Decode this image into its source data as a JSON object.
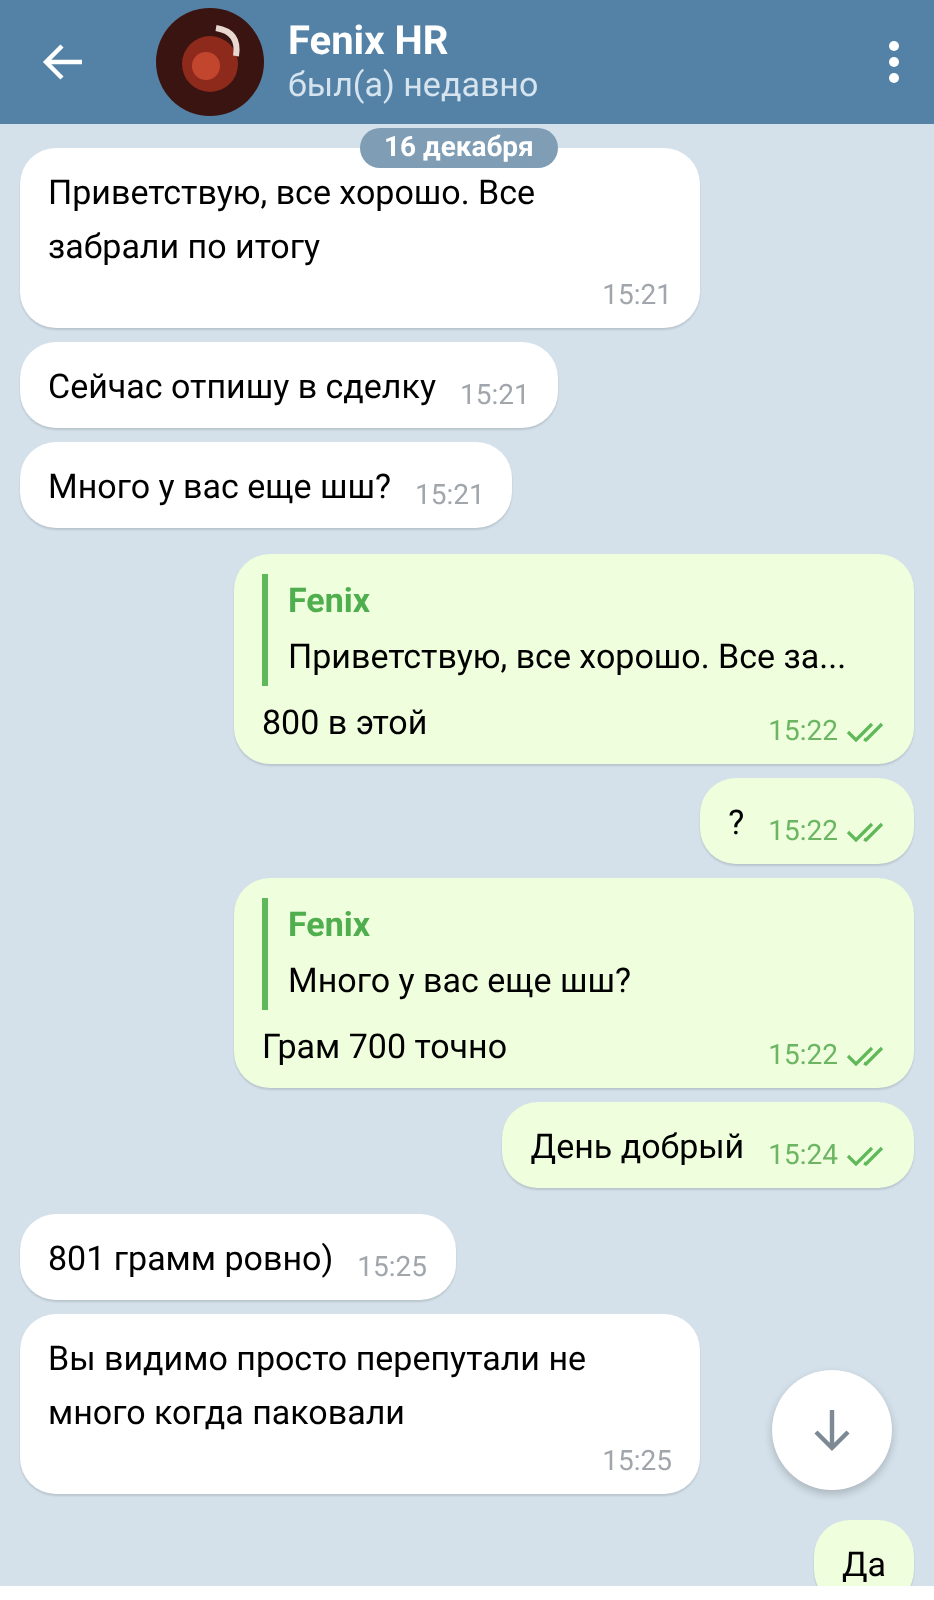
{
  "header": {
    "title": "Fenix HR",
    "status": "был(а) недавно"
  },
  "date_badge": "16 декабря",
  "messages": [
    {
      "kind": "incoming",
      "text": "Приветствую, все хорошо. Все забрали по итогу",
      "time": "15:21"
    },
    {
      "kind": "incoming",
      "text": "Сейчас отпишу в сделку",
      "time": "15:21"
    },
    {
      "kind": "incoming",
      "text": "Много у вас еще шш?",
      "time": "15:21"
    },
    {
      "kind": "outgoing",
      "reply": {
        "name": "Fenix",
        "text": "Приветствую, все хорошо. Все за..."
      },
      "text": "800 в этой",
      "time": "15:22",
      "read": true
    },
    {
      "kind": "outgoing",
      "text": "?",
      "time": "15:22",
      "read": true
    },
    {
      "kind": "outgoing",
      "reply": {
        "name": "Fenix",
        "text": "Много у вас еще шш?"
      },
      "text": "Грам 700 точно",
      "time": "15:22",
      "read": true
    },
    {
      "kind": "outgoing",
      "text": "День добрый",
      "time": "15:24",
      "read": true
    },
    {
      "kind": "incoming",
      "text": "801 грамм ровно)",
      "time": "15:25"
    },
    {
      "kind": "incoming",
      "text": "Вы видимо просто перепутали не много когда паковали",
      "time": "15:25"
    },
    {
      "kind": "outgoing",
      "text": "Да"
    }
  ]
}
